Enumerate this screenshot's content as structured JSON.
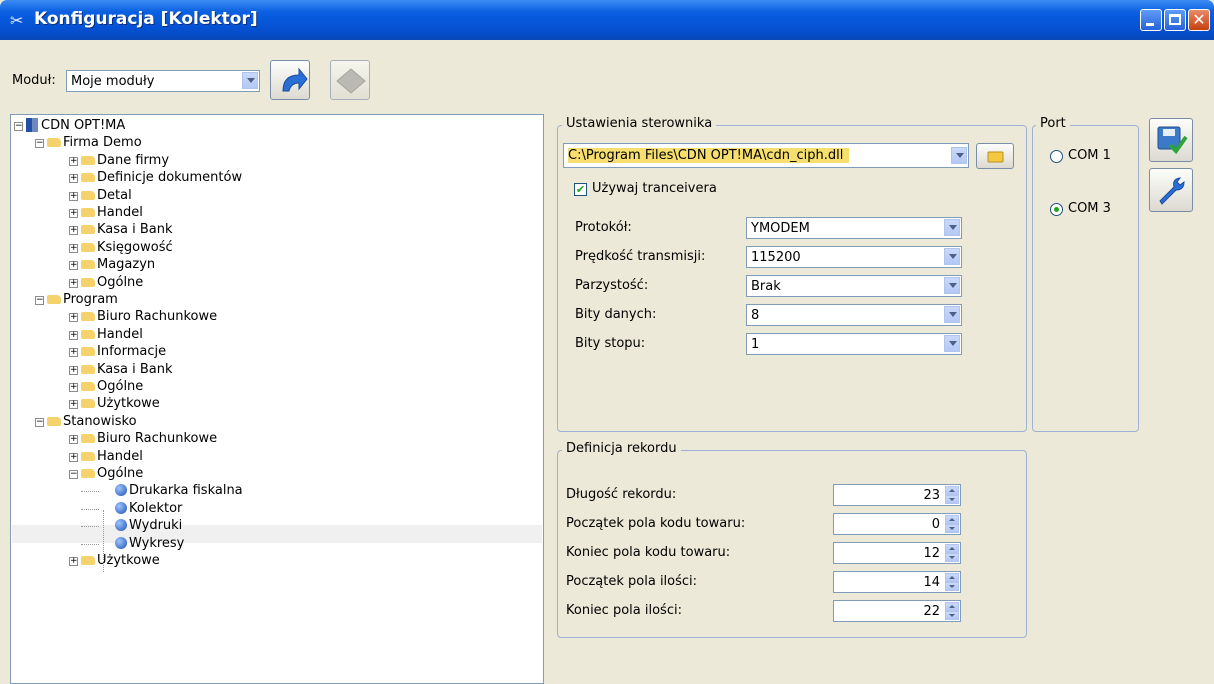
{
  "window": {
    "title": "Konfiguracja [Kolektor]",
    "app_icon": "tools-icon",
    "close_glyph": "✕"
  },
  "toolbar": {
    "modul_label": "Moduł:",
    "modul_value": "Moje moduły"
  },
  "tree": {
    "root": "CDN OPT!MA",
    "firma": "Firma Demo",
    "firma_items": [
      "Dane firmy",
      "Definicje dokumentów",
      "Detal",
      "Handel",
      "Kasa i Bank",
      "Księgowość",
      "Magazyn",
      "Ogólne"
    ],
    "program": "Program",
    "program_items": [
      "Biuro Rachunkowe",
      "Handel",
      "Informacje",
      "Kasa i Bank",
      "Ogólne",
      "Użytkowe"
    ],
    "stanowisko": "Stanowisko",
    "stanowisko_items": [
      "Biuro Rachunkowe",
      "Handel",
      "Ogólne"
    ],
    "ogolne_items": [
      "Drukarka fiskalna",
      "Kolektor",
      "Wydruki",
      "Wykresy"
    ],
    "last_item": "Użytkowe",
    "selected": "Kolektor"
  },
  "driver": {
    "legend": "Ustawienia sterownika",
    "path": "C:\\Program Files\\CDN OPT!MA\\cdn_ciph.dll",
    "checkbox_label": "Używaj tranceivera",
    "checkbox_checked": true,
    "fields": [
      {
        "label": "Protokół:",
        "value": "YMODEM"
      },
      {
        "label": "Prędkość transmisji:",
        "value": "115200"
      },
      {
        "label": "Parzystość:",
        "value": "Brak"
      },
      {
        "label": "Bity danych:",
        "value": "8"
      },
      {
        "label": "Bity stopu:",
        "value": "1"
      }
    ]
  },
  "port": {
    "legend": "Port",
    "options": [
      "COM 1",
      "COM 3"
    ],
    "selected": "COM 3"
  },
  "record": {
    "legend": "Definicja rekordu",
    "fields": [
      {
        "label": "Długość rekordu:",
        "value": "23"
      },
      {
        "label": "Początek pola kodu towaru:",
        "value": "0"
      },
      {
        "label": "Koniec pola kodu towaru:",
        "value": "12"
      },
      {
        "label": "Początek pola ilości:",
        "value": "14"
      },
      {
        "label": "Koniec pola ilości:",
        "value": "22"
      }
    ]
  },
  "colors": {
    "titlebar": "#0551d4",
    "face": "#ece9d8",
    "border": "#7f9db9",
    "accent_green": "#21a121"
  }
}
